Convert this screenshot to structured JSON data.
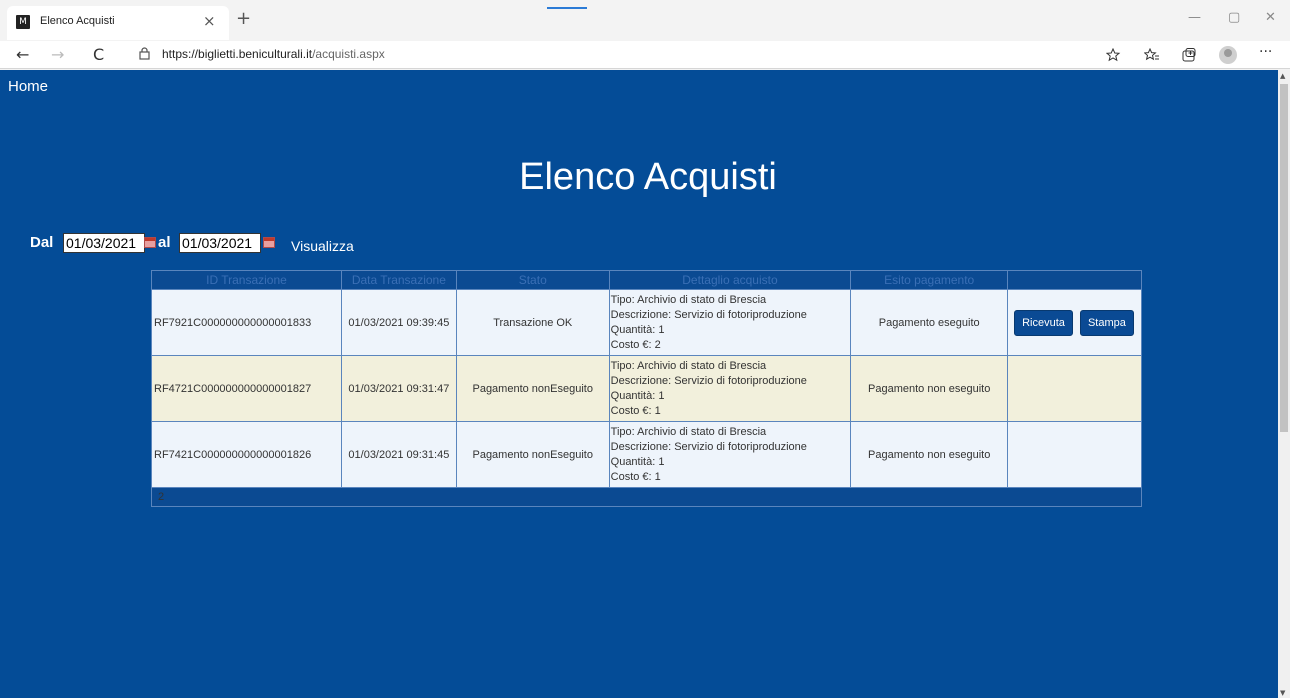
{
  "browser": {
    "tab_title": "Elenco Acquisti",
    "tab_close": "×",
    "new_tab": "+",
    "url_host": "https://biglietti.beniculturali.it",
    "url_path": "/acquisti.aspx",
    "win_minimize": "—",
    "win_maximize": "▢",
    "win_close": "✕",
    "back": "←",
    "forward": "→",
    "refresh": "C",
    "favicon": "M",
    "more": "···"
  },
  "page": {
    "home_link": "Home",
    "title": "Elenco Acquisti",
    "filter": {
      "from_label": "Dal",
      "from_value": "01/03/2021",
      "to_label": "al",
      "to_value": "01/03/2021",
      "submit_label": "Visualizza"
    }
  },
  "table": {
    "headers": [
      "ID Transazione",
      "Data Transazione",
      "Stato",
      "Dettaglio acquisto",
      "Esito pagamento",
      ""
    ],
    "rows": [
      {
        "id": "RF7921C000000000000001833",
        "data": "01/03/2021 09:39:45",
        "stato": "Transazione OK",
        "tipo": "Tipo: Archivio di stato di Brescia",
        "descrizione": "Descrizione: Servizio di fotoriproduzione",
        "quantita": "Quantità: 1",
        "costo": "Costo €: 2",
        "esito": "Pagamento eseguito",
        "ricevuta": "Ricevuta",
        "stampa": "Stampa"
      },
      {
        "id": "RF4721C000000000000001827",
        "data": "01/03/2021 09:31:47",
        "stato": "Pagamento nonEseguito",
        "tipo": "Tipo: Archivio di stato di Brescia",
        "descrizione": "Descrizione: Servizio di fotoriproduzione",
        "quantita": "Quantità: 1",
        "costo": "Costo €: 1",
        "esito": "Pagamento non eseguito"
      },
      {
        "id": "RF7421C000000000000001826",
        "data": "01/03/2021 09:31:45",
        "stato": "Pagamento nonEseguito",
        "tipo": "Tipo: Archivio di stato di Brescia",
        "descrizione": "Descrizione: Servizio di fotoriproduzione",
        "quantita": "Quantità: 1",
        "costo": "Costo €: 1",
        "esito": "Pagamento non eseguito"
      }
    ],
    "pager": "2"
  }
}
